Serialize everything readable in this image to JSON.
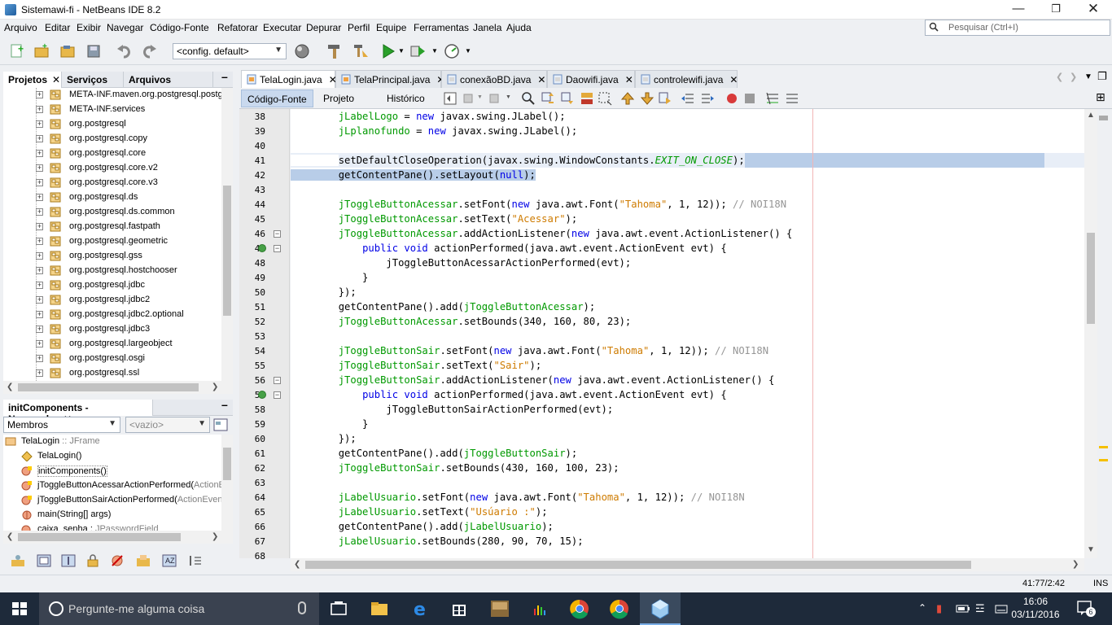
{
  "window": {
    "title": "Sistemawi-fi - NetBeans IDE 8.2"
  },
  "menu": [
    "Arquivo",
    "Editar",
    "Exibir",
    "Navegar",
    "Código-Fonte",
    "Refatorar",
    "Executar",
    "Depurar",
    "Perfil",
    "Equipe",
    "Ferramentas",
    "Janela",
    "Ajuda"
  ],
  "search": {
    "placeholder": "Pesquisar (Ctrl+I)"
  },
  "toolbar": {
    "config": "<config. default>"
  },
  "projects_panel": {
    "tabs": [
      "Projetos",
      "Serviços",
      "Arquivos"
    ],
    "items": [
      "META-INF.maven.org.postgresql.postg",
      "META-INF.services",
      "org.postgresql",
      "org.postgresql.copy",
      "org.postgresql.core",
      "org.postgresql.core.v2",
      "org.postgresql.core.v3",
      "org.postgresql.ds",
      "org.postgresql.ds.common",
      "org.postgresql.fastpath",
      "org.postgresql.geometric",
      "org.postgresql.gss",
      "org.postgresql.hostchooser",
      "org.postgresql.jdbc",
      "org.postgresql.jdbc2",
      "org.postgresql.jdbc2.optional",
      "org.postgresql.jdbc3",
      "org.postgresql.largeobject",
      "org.postgresql.osgi",
      "org.postgresql.ssl"
    ]
  },
  "navigator": {
    "title": "initComponents - Navegador",
    "filter": "Membros",
    "filter2": "<vazio>",
    "root": {
      "name": "TelaLogin",
      "type": " :: JFrame"
    },
    "items": [
      {
        "name": "TelaLogin()",
        "extra": ""
      },
      {
        "name": "initComponents()",
        "extra": ""
      },
      {
        "name": "jToggleButtonAcessarActionPerformed(",
        "extra": "ActionE"
      },
      {
        "name": "jToggleButtonSairActionPerformed(",
        "extra": "ActionEven"
      },
      {
        "name": "main(String[] args)",
        "extra": ""
      },
      {
        "name": "caixa_senha : ",
        "extra": "JPasswordField"
      }
    ]
  },
  "editor": {
    "tabs": [
      "TelaLogin.java",
      "TelaPrincipal.java",
      "conexãoBD.java",
      "Daowifi.java",
      "controlewifi.java"
    ],
    "views": [
      "Código-Fonte",
      "Projeto",
      "Histórico"
    ],
    "line_numbers": [
      "38",
      "39",
      "40",
      "41",
      "42",
      "43",
      "44",
      "45",
      "46",
      "47",
      "48",
      "49",
      "50",
      "51",
      "52",
      "53",
      "54",
      "55",
      "56",
      "57",
      "58",
      "59",
      "60",
      "61",
      "62",
      "63",
      "64",
      "65",
      "66",
      "67",
      "68"
    ]
  },
  "status": {
    "position": "41:77/2:42",
    "mode": "INS"
  },
  "taskbar": {
    "search_placeholder": "Pergunte-me alguma coisa",
    "time": "16:06",
    "date": "03/11/2016",
    "notifications": "6"
  }
}
